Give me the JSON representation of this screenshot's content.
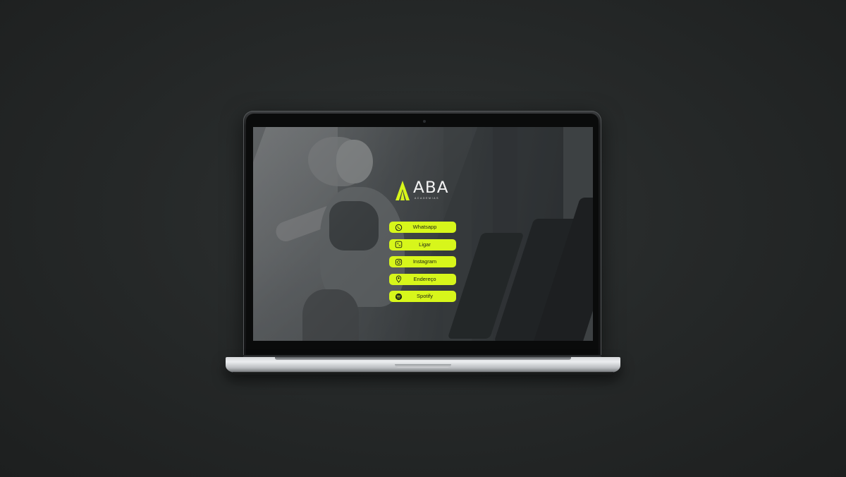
{
  "brand": {
    "name": "ABA",
    "tagline": "ACADEMIAS"
  },
  "links": [
    {
      "label": "Whatsapp",
      "icon": "whatsapp-icon"
    },
    {
      "label": "Ligar",
      "icon": "phone-icon"
    },
    {
      "label": "Instagram",
      "icon": "instagram-icon"
    },
    {
      "label": "Endereço",
      "icon": "location-pin-icon"
    },
    {
      "label": "Spotify",
      "icon": "spotify-icon"
    }
  ],
  "colors": {
    "accent": "#d7f61b",
    "background": "#262929",
    "logo_mark": "#d7f61b"
  }
}
